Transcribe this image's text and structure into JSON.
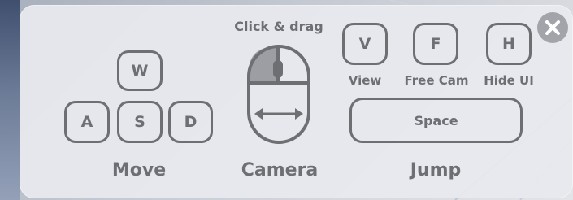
{
  "header": {
    "camera_hint": "Click & drag"
  },
  "keys": {
    "w": "W",
    "a": "A",
    "s": "S",
    "d": "D",
    "v": "V",
    "f": "F",
    "h": "H",
    "space": "Space"
  },
  "labels": {
    "view": "View",
    "free_cam": "Free Cam",
    "hide_ui": "Hide UI"
  },
  "sections": {
    "move": "Move",
    "camera": "Camera",
    "jump": "Jump"
  },
  "icons": {
    "close": "close-icon",
    "mouse": "mouse-icon",
    "drag_arrow": "horizontal-arrow-icon"
  },
  "colors": {
    "key_stroke": "#6e6f73",
    "panel": "#e8eaef",
    "close_bg": "#96989e"
  }
}
